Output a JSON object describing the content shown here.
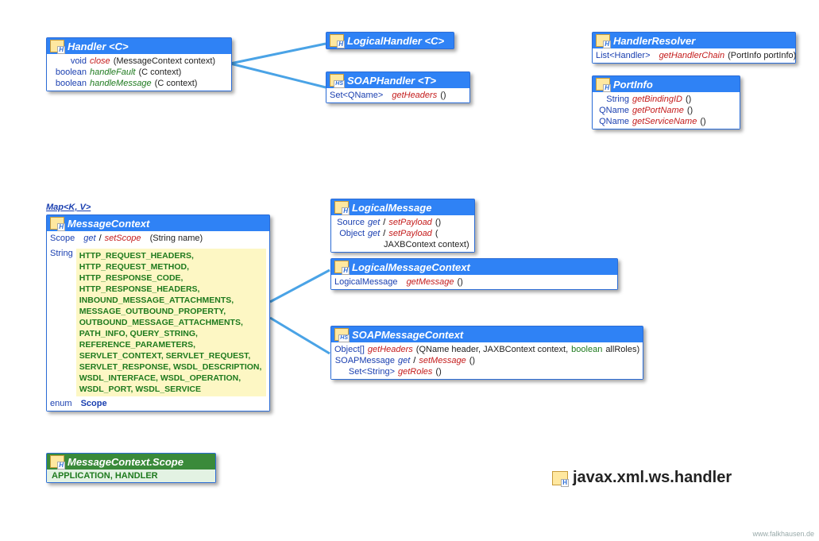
{
  "package": "javax.xml.ws.handler",
  "footer": "www.falkhausen.de",
  "mapLink": "Map<K, V>",
  "classes": {
    "handler": {
      "title": "Handler",
      "tparam": "<C>",
      "rows": [
        {
          "ret": "void",
          "name": "close",
          "style": "r",
          "args": "(MessageContext context)"
        },
        {
          "ret": "boolean",
          "name": "handleFault",
          "style": "g",
          "args": "(C context)"
        },
        {
          "ret": "boolean",
          "name": "handleMessage",
          "style": "g",
          "args": "(C context)"
        }
      ]
    },
    "logicalHandler": {
      "title": "LogicalHandler",
      "tparam": "<C>"
    },
    "soapHandler": {
      "title": "SOAPHandler",
      "tparam": "<T>",
      "rows": [
        {
          "ret": "Set<QName>",
          "name": "getHeaders",
          "style": "r",
          "args": "()"
        }
      ]
    },
    "handlerResolver": {
      "title": "HandlerResolver",
      "rows": [
        {
          "ret": "List<Handler>",
          "name": "getHandlerChain",
          "style": "r",
          "args": "(PortInfo portInfo)"
        }
      ]
    },
    "portInfo": {
      "title": "PortInfo",
      "rows": [
        {
          "ret": "String",
          "name": "getBindingID",
          "style": "r",
          "args": "()"
        },
        {
          "ret": "QName",
          "name": "getPortName",
          "style": "r",
          "args": "()"
        },
        {
          "ret": "QName",
          "name": "getServiceName",
          "style": "r",
          "args": "()"
        }
      ]
    },
    "messageContext": {
      "title": "MessageContext",
      "scopeRow": {
        "ret": "Scope",
        "prefix": "get",
        "sep": "/",
        "suffix": "setScope",
        "args": "(String name)"
      },
      "constPrefix": "String",
      "consts": "HTTP_REQUEST_HEADERS, HTTP_REQUEST_METHOD, HTTP_RESPONSE_CODE, HTTP_RESPONSE_HEADERS, INBOUND_MESSAGE_ATTACHMENTS, MESSAGE_OUTBOUND_PROPERTY, OUTBOUND_MESSAGE_ATTACHMENTS, PATH_INFO, QUERY_STRING, REFERENCE_PARAMETERS, SERVLET_CONTEXT, SERVLET_REQUEST, SERVLET_RESPONSE, WSDL_DESCRIPTION, WSDL_INTERFACE, WSDL_OPERATION, WSDL_PORT, WSDL_SERVICE",
      "enumLabel": "enum",
      "enumName": "Scope"
    },
    "scopeEnum": {
      "title": "MessageContext.Scope",
      "values": "APPLICATION, HANDLER"
    },
    "logicalMessage": {
      "title": "LogicalMessage",
      "rows": [
        {
          "ret": "Source",
          "gs": true,
          "name": "Payload",
          "args": "()"
        },
        {
          "ret": "Object",
          "gs": true,
          "name": "Payload",
          "args": "("
        },
        {
          "ret": "",
          "name": "",
          "args": "JAXBContext context)",
          "indent": true
        }
      ]
    },
    "logicalMessageContext": {
      "title": "LogicalMessageContext",
      "rows": [
        {
          "ret": "LogicalMessage",
          "name": "getMessage",
          "style": "r",
          "args": "()"
        }
      ]
    },
    "soapMessageContext": {
      "title": "SOAPMessageContext",
      "rows": [
        {
          "ret": "Object[]",
          "name": "getHeaders",
          "style": "r",
          "args": " (QName header, JAXBContext context, ",
          "tail": "boolean",
          "tail2": " allRoles)"
        },
        {
          "ret": "SOAPMessage",
          "gs": true,
          "name": "Message",
          "args": "()"
        },
        {
          "ret": "Set<String>",
          "name": "getRoles",
          "style": "r",
          "args": "()"
        }
      ]
    }
  }
}
